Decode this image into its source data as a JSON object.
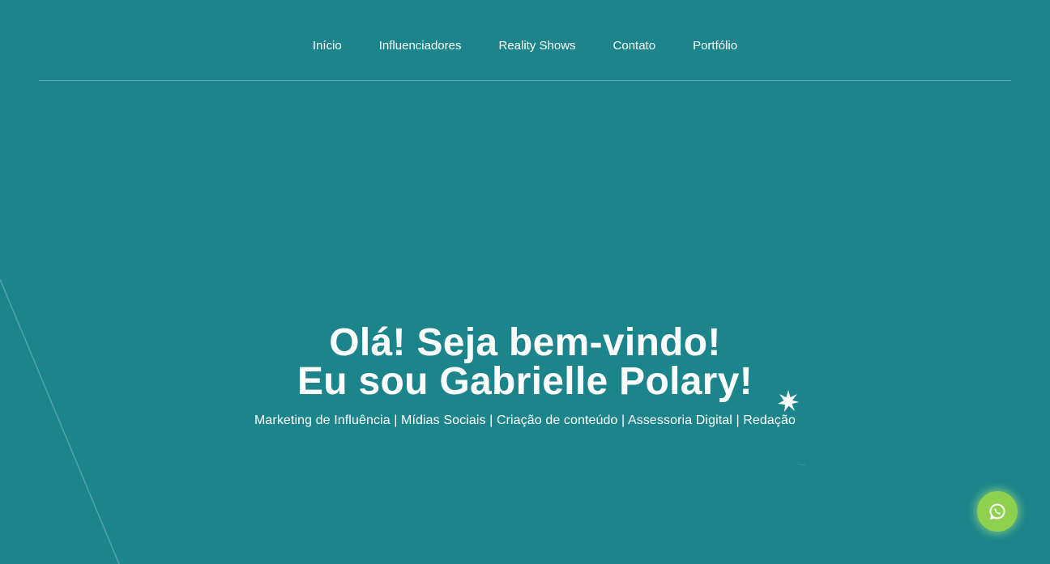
{
  "nav": {
    "items": [
      {
        "label": "Início"
      },
      {
        "label": "Influenciadores"
      },
      {
        "label": "Reality Shows"
      },
      {
        "label": "Contato"
      },
      {
        "label": "Portfólio"
      }
    ]
  },
  "hero": {
    "title_line1": "Olá! Seja bem-vindo!",
    "title_line2": "Eu sou Gabrielle Polary!",
    "subtitle": "Marketing de Influência | Mídias Sociais | Criação de conteúdo | Assessoria Digital | Redação"
  },
  "decor": {
    "moon_icon": "crescent-moon-star-icon"
  },
  "floating": {
    "whatsapp_icon": "whatsapp-icon"
  },
  "colors": {
    "background": "#1c848b",
    "text": "#ffffff",
    "whatsapp_button": "#8fd14f"
  }
}
